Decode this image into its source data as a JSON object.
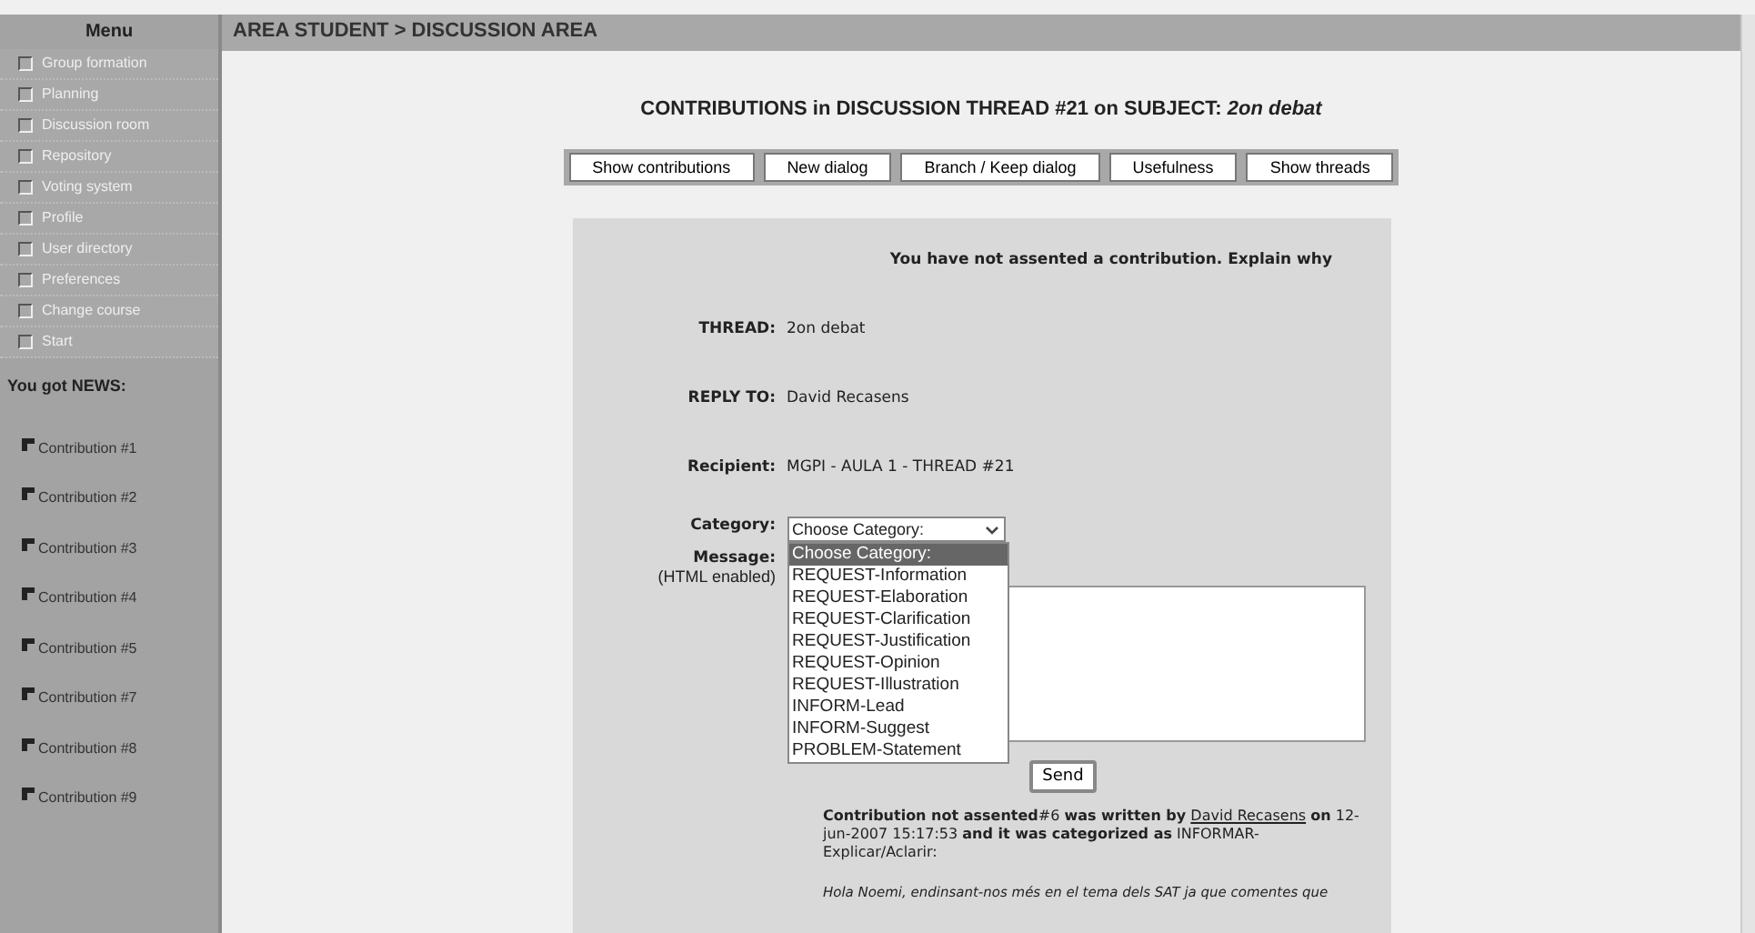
{
  "sidebar": {
    "title": "Menu",
    "items": [
      {
        "label": "Group formation"
      },
      {
        "label": "Planning"
      },
      {
        "label": "Discussion room"
      },
      {
        "label": "Repository"
      },
      {
        "label": "Voting system"
      },
      {
        "label": "Profile"
      },
      {
        "label": "User directory"
      },
      {
        "label": "Preferences"
      },
      {
        "label": "Change course"
      },
      {
        "label": "Start"
      }
    ],
    "news_title": "You got NEWS:",
    "news": [
      {
        "label": "Contribution #1"
      },
      {
        "label": "Contribution #2"
      },
      {
        "label": "Contribution #3"
      },
      {
        "label": "Contribution #4"
      },
      {
        "label": "Contribution #5"
      },
      {
        "label": "Contribution #7"
      },
      {
        "label": "Contribution #8"
      },
      {
        "label": "Contribution #9"
      }
    ]
  },
  "breadcrumb": "AREA STUDENT > DISCUSSION AREA",
  "heading": "CONTRIBUTIONS in DISCUSSION THREAD #21 on SUBJECT: *2on debat*",
  "toolbar": [
    "Show contributions",
    "New dialog",
    "Branch / Keep dialog",
    "Usefulness",
    "Show threads"
  ],
  "form": {
    "notice": "You have not assented a contribution. Explain why",
    "fields": [
      {
        "label": "THREAD:",
        "value": "2on debat"
      },
      {
        "label": "REPLY TO:",
        "value": "David Recasens"
      },
      {
        "label": "Recipient:",
        "value": "MGPI - AULA 1 - THREAD #21"
      }
    ],
    "category_label": "Category:",
    "category_value": "Choose Category:",
    "category_options": [
      {
        "label": "Choose Category:",
        "selected": true
      },
      {
        "label": "REQUEST-Information",
        "selected": false
      },
      {
        "label": "REQUEST-Elaboration",
        "selected": false
      },
      {
        "label": "REQUEST-Clarification",
        "selected": false
      },
      {
        "label": "REQUEST-Justification",
        "selected": false
      },
      {
        "label": "REQUEST-Opinion",
        "selected": false
      },
      {
        "label": "REQUEST-Illustration",
        "selected": false
      },
      {
        "label": "INFORM-Lead",
        "selected": false
      },
      {
        "label": "INFORM-Suggest",
        "selected": false
      },
      {
        "label": "PROBLEM-Statement",
        "selected": false
      }
    ],
    "message_label": "Message:",
    "message_hint": "(HTML enabled)",
    "send": "Send"
  },
  "contribution": {
    "before": "**Contribution not assented**#6 **was written by**",
    "author": "David Recasens",
    "after": "**on** 12-jun-2007 15:17:53 **and it was categorized as** INFORMAR-Explicar/Aclarir:",
    "body": "Hola Noemi, endinsant-nos més en el tema dels SAT ja que comentes que"
  }
}
